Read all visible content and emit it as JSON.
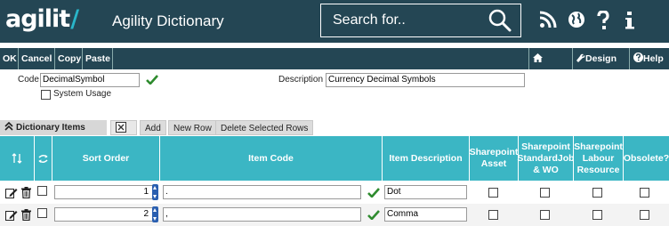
{
  "header": {
    "logo_text": "agilit",
    "logo_slash": "/",
    "app_title": "Agility Dictionary",
    "search_placeholder": "Search for.."
  },
  "toolbar": {
    "ok": "OK",
    "cancel": "Cancel",
    "copy": "Copy",
    "paste": "Paste",
    "home": "Home",
    "design": "Design",
    "help": "Help"
  },
  "form": {
    "code_label": "Code",
    "code_value": "DecimalSymbol",
    "system_usage_label": "System Usage",
    "description_label": "Description",
    "description_value": "Currency Decimal Symbols"
  },
  "grid": {
    "tab_label": "Dictionary Items",
    "add_label": "Add",
    "new_row_label": "New Row",
    "delete_selected_label": "Delete Selected Rows",
    "columns": {
      "sort_order": "Sort Order",
      "item_code": "Item Code",
      "item_description": "Item Description",
      "sharepoint_asset": "Sharepoint Asset",
      "sharepoint_standardjob": "Sharepoint StandardJob & WO",
      "sharepoint_labour": "Sharepoint Labour Resource",
      "obsolete": "Obsolete?"
    },
    "rows": [
      {
        "sort_order": "1",
        "item_code": ".",
        "item_description": "Dot"
      },
      {
        "sort_order": "2",
        "item_code": ",",
        "item_description": "Comma"
      }
    ]
  },
  "colors": {
    "header_bg": "#244654",
    "table_header_bg": "#3bb6c4",
    "check_green": "#2e8b2e"
  }
}
